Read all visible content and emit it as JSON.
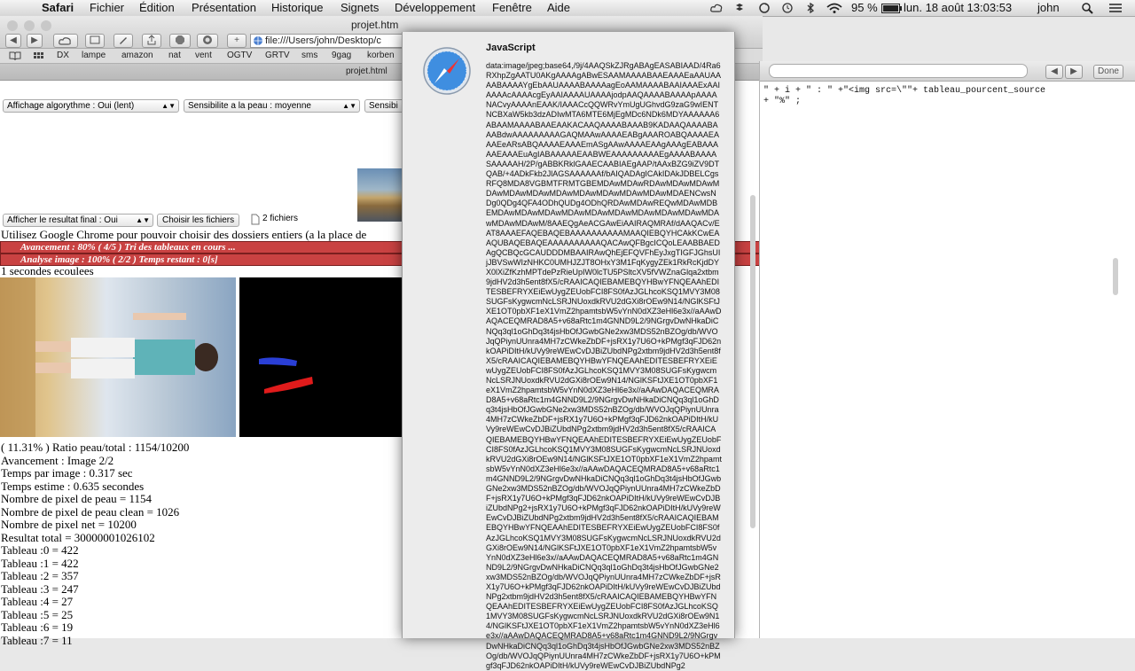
{
  "menubar": {
    "app": "Safari",
    "items": [
      "Fichier",
      "Édition",
      "Présentation",
      "Historique",
      "Signets",
      "Développement",
      "Fenêtre",
      "Aide"
    ],
    "battery": "95 %",
    "clock": "lun. 18 août  13:03:53",
    "user": "john"
  },
  "window": {
    "title": "projet.htm",
    "url": "file:///Users/john/Desktop/c",
    "tab_title": "projet.html",
    "bookmarks": [
      "DX",
      "lampe",
      "amazon",
      "nat",
      "vent",
      "OGTV",
      "GRTV",
      "sms",
      "9gag",
      "korben"
    ]
  },
  "page": {
    "select_algo": "Affichage algorythme : Oui (lent)",
    "select_skin": "Sensibilite a la peau : moyenne",
    "select_skin2": "Sensibi",
    "select_result": "Afficher le resultat final : Oui",
    "choose_files": "Choisir les fichiers",
    "files_count": "2 fichiers",
    "chrome_note": "Utilisez Google Chrome pour pouvoir choisir des dossiers entiers (a la place de",
    "progress1": "Avancement : 80% ( 4/5 ) Tri des tableaux en cours ...",
    "progress2": "Analyse image : 100% ( 2/2 ) Temps restant : 0[s]",
    "elapsed": "1 secondes ecoulees",
    "stats": [
      "( 11.31% ) Ratio peau/total : 1154/10200",
      "Avancement : Image 2/2",
      "Temps par image : 0.317 sec",
      "Temps estime : 0.635 secondes",
      "Nombre de pixel de peau = 1154",
      "Nombre de pixel de peau clean = 1026",
      "Nombre de pixel net = 10200",
      "Resultat total = 30000001026102",
      "Tableau :0 = 422",
      "Tableau :1 = 422",
      "Tableau :2 = 357",
      "Tableau :3 = 247",
      "Tableau :4 = 27",
      "Tableau :5 = 25",
      "Tableau :6 = 19",
      "Tableau :7 = 11"
    ]
  },
  "dialog": {
    "title": "JavaScript",
    "text": "data:image/jpeg;base64,/9j/4AAQSkZJRgABAgEASABIAAD/4Ra6RXhpZgAATU0AKgAAAAgABwESAAMAAAABAAEAAAEaAAUAAAABAAAAYgEbAAUAAAABAAAAagEoAAMAAAABAAIAAAExAAIAAAAcAAAAcgEyAAIAAAAUAAAAjodpAAQAAAABAAAApAAAANACvyAAAAnEAAK/IAAACcQQWRvYmUgUGhvdG9zaG9wIENTNCBXaW5kb3dzADIwMTA6MTE6MjEgMDc6NDk6MDYAAAAAA6ABAAMAAAABAAEAAKACAAQAAAABAAAB9KADAAQAAAABAAABdwAAAAAAAAAGAQMAAwAAAAEABgAAAROABQAAAAEAAAEeARsABQAAAAEAAAEmASgAAwAAAAEAAgAAAgEABAAAAAEAAAEuAgIABAAAAAEAABWEAAAAAAAAAEgAAAABAAAASAAAAAH/2P/gABBKRklGAAECAABIAEgAAP/tAAxBZG9iZV9DTQAB/+4ADkFkb2JlAGSAAAAAAf/bAIQADAgICAkIDAkJDBELCgsRFQ8MDA8VGBMTFRMTGBEMDAwMDAwRDAwMDAwMDAwMDAwMDAwMDAwMDAwMDAwMDAwMDAwMDAwMDAENCwsNDg0QDg4QFA4ODhQUDg4ODhQRDAwMDAwREQwMDAwMDBEMDAwMDAwMDAwMDAwMDAwMDAwMDAwMDAwMDAwMDAwMDAwMDAwM/8AAEQgAeACGAwEiAAIRAQMRAf/dAAQACv/EAT8AAAEFAQEBAQEBAAAAAAAAAAMAAQIEBQYHCAkKCwEAAQUBAQEBAQEAAAAAAAAAAQACAwQFBgcICQoLEAABBAEDAgQCBQcGCAUDDDMBAAIRAwQhEjEFQVFhEyJxgTIGFJGhsUIjJBVSwWIzNHKC0UMHJZJT8OHxY3M1FqKygyZEk1RkRcKjdDYX0lXiZfKzhMPTdePzRieUpIW0lcTU5PSltcXV5fVWZnaGlqa2xtbm9jdHV2d3h5ent8fX5/cRAAICAQIEBAMEBQYHBwYFNQEAAhEDITESBEFRYXEiEwUygZEUobFCI8FS0fAzJGLhcoKSQ1MVY3M08SUGFsKygwcmNcLSRJNUoxdkRVU2dGXi8rOEw9N14/NGlKSFtJXE1OT0pbXF1eX1VmZ2hpamtsbW5vYnN0dXZ3eHl6e3x//aAAwDAQACEQMRAD8A5+v68aRtc1m4GNND9L2/9NGrgvDwNHkaDiCNQq3ql1oGhDq3t4jsHbOfJGwbGNe2xw3MDS52nBZOg/db/WVOJqQPiynUUnra4MH7zCWkeZbDF+jsRX1y7U6O+kPMgf3qFJD62nkOAPiDItH/kUVy9reWEwCvDJBiZUbdNPg2xtbm9jdHV2d3h5ent8fX5/cRAAICAQIEBAMEBQYHBwYFNQEAAhEDITESBEFRYXEiEwUygZEUobFCI8FS0fAzJGLhcoKSQ1MVY3M08SUGFsKygwcmNcLSRJNUoxdkRVU2dGXi8rOEw9N14/NGlKSFtJXE1OT0pbXF1eX1VmZ2hpamtsbW5vYnN0dXZ3eHl6e3x//aAAwDAQACEQMRAD8A5+v68aRtc1m4GNND9L2/9NGrgvDwNHkaDiCNQq3ql1oGhDq3t4jsHbOfJGwbGNe2xw3MDS52nBZOg/db/WVOJqQPiynUUnra4MH7zCWkeZbDF+jsRX1y7U6O+kPMgf3qFJD62nkOAPiDItH/kUVy9reWEwCvDJBiZUbdNPg2xtbm9jdHV2d3h5ent8fX5/cRAAICAQIEBAMEBQYHBwYFNQEAAhEDITESBEFRYXEiEwUygZEUobFCI8FS0fAzJGLhcoKSQ1MVY3M08SUGFsKygwcmNcLSRJNUoxdkRVU2dGXi8rOEw9N14/NGlKSFtJXE1OT0pbXF1eX1VmZ2hpamtsbW5vYnN0dXZ3eHl6e3x//aAAwDAQACEQMRAD8A5+v68aRtc1m4GNND9L2/9NGrgvDwNHkaDiCNQq3ql1oGhDq3t4jsHbOfJGwbGNe2xw3MDS52nBZOg/db/WVOJqQPiynUUnra4MH7zCWkeZbDF+jsRX1y7U6O+kPMgf3qFJD62nkOAPiDItH/kUVy9reWEwCvDJBiZUbdNPg2+jsRX1y7U6O+kPMgf3qFJD62nkOAPiDItH/kUVy9reWEwCvDJBiZUbdNPg2xtbm9jdHV2d3h5ent8fX5/cRAAICAQIEBAMEBQYHBwYFNQEAAhEDITESBEFRYXEiEwUygZEUobFCI8FS0fAzJGLhcoKSQ1MVY3M08SUGFsKygwcmNcLSRJNUoxdkRVU2dGXi8rOEw9N14/NGlKSFtJXE1OT0pbXF1eX1VmZ2hpamtsbW5vYnN0dXZ3eHl6e3x//aAAwDAQACEQMRAD8A5+v68aRtc1m4GNND9L2/9NGrgvDwNHkaDiCNQq3ql1oGhDq3t4jsHbOfJGwbGNe2xw3MDS52nBZOg/db/WVOJqQPiynUUnra4MH7zCWkeZbDF+jsRX1y7U6O+kPMgf3qFJD62nkOAPiDItH/kUVy9reWEwCvDJBiZUbdNPg2xtbm9jdHV2d3h5ent8fX5/cRAAICAQIEBAMEBQYHBwYFNQEAAhEDITESBEFRYXEiEwUygZEUobFCI8FS0fAzJGLhcoKSQ1MVY3M08SUGFsKygwcmNcLSRJNUoxdkRVU2dGXi8rOEw9N14/NGlKSFtJXE1OT0pbXF1eX1VmZ2hpamtsbW5vYnN0dXZ3eHl6e3x//aAAwDAQACEQMRAD8A5+v68aRtc1m4GNND9L2/9NGrgvDwNHkaDiCNQq3ql1oGhDq3t4jsHbOfJGwbGNe2xw3MDS52nBZOg/db/WVOJqQPiynUUnra4MH7zCWkeZbDF+jsRX1y7U6O+kPMgf3qFJD62nkOAPiDItH/kUVy9reWEwCvDJBiZUbdNPg2"
  },
  "devtools": {
    "done": "Done",
    "code_line1": "\" + i + \" : \" +\"<img src=\\\"\"+ tableau_pourcent_source",
    "code_line2": "+ \"%\" ;"
  },
  "colors": {
    "progress_bar": "#c94242",
    "menubar": "#e6e6e6"
  }
}
